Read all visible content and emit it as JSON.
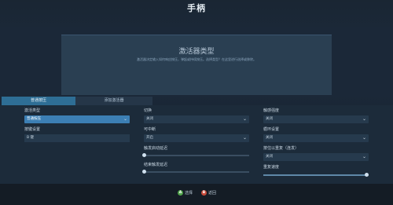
{
  "page": {
    "title": "手柄"
  },
  "dialog": {
    "title": "激活器类型",
    "description": "激活器决定输入如何响应按压，弹起或持续按压。选择类型？在这里进行选择或移除。"
  },
  "tabs": [
    {
      "label": "普通按压",
      "active": true
    },
    {
      "label": "添加激活器",
      "active": false
    }
  ],
  "left": {
    "activator_type": {
      "label": "激活类型",
      "value": "普通按压"
    },
    "key_binding": {
      "label": "按键设置",
      "value": "B 键"
    }
  },
  "middle": {
    "toggle": {
      "label": "切换",
      "value": "关闭"
    },
    "interruptible": {
      "label": "可中断",
      "value": "开启"
    },
    "fire_start_delay": {
      "label": "触发启动延迟",
      "level": 0.0
    },
    "fire_end_delay": {
      "label": "结束触发延迟",
      "level": 0.0
    }
  },
  "right": {
    "haptic_strength": {
      "label": "触感强度",
      "value": "关闭"
    },
    "cycle": {
      "label": "循环设置",
      "value": "关闭"
    },
    "hold_to_repeat": {
      "label": "按住以重复（连发）",
      "value": "关闭"
    },
    "repeat_rate": {
      "label": "重复速度",
      "level": 0.98
    }
  },
  "footer": {
    "select": {
      "glyph": "A",
      "label": "选择"
    },
    "back": {
      "glyph": "B",
      "label": "返回"
    }
  }
}
